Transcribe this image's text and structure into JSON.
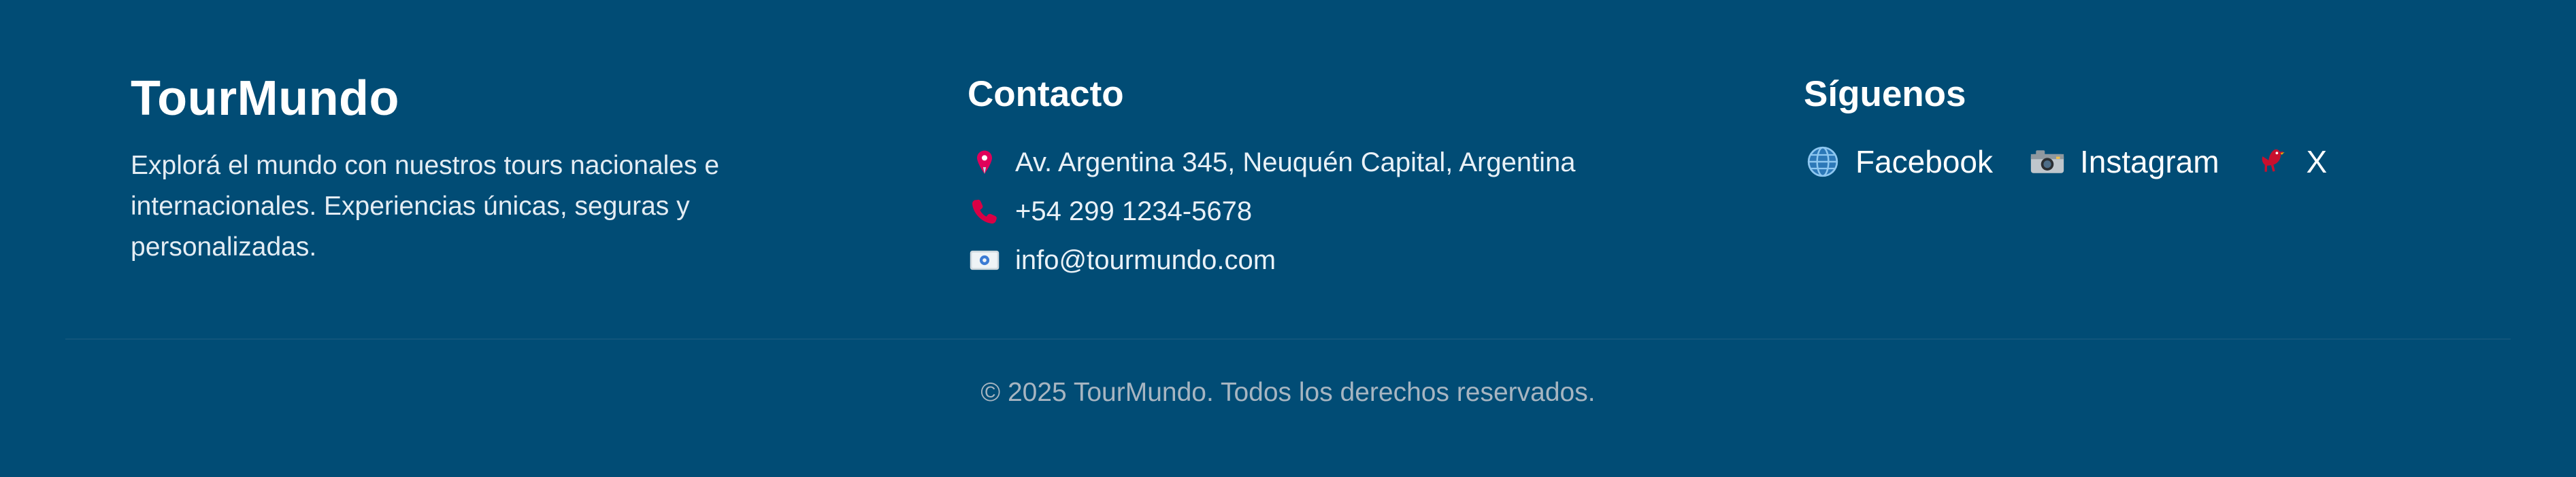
{
  "colors": {
    "background": "#014c75",
    "text_primary": "#ffffff",
    "text_secondary": "#e4edf4",
    "copyright_text": "#a7b5c1",
    "divider": "#11557b",
    "pin_icon": "#e0005a",
    "phone_icon": "#d90045",
    "globe_icon": "#4a90c2",
    "bird_icon": "#c8102e"
  },
  "brand": {
    "title": "TourMundo",
    "description": "Explorá el mundo con nuestros tours nacionales e internacionales. Experiencias únicas, seguras y personalizadas."
  },
  "contact": {
    "title": "Contacto",
    "items": [
      {
        "icon": "location-pin-icon",
        "text": "Av. Argentina 345, Neuquén Capital, Argentina"
      },
      {
        "icon": "phone-icon",
        "text": "+54 299 1234-5678"
      },
      {
        "icon": "email-icon",
        "text": "info@tourmundo.com"
      }
    ]
  },
  "social": {
    "title": "Síguenos",
    "links": [
      {
        "icon": "globe-icon",
        "label": "Facebook"
      },
      {
        "icon": "camera-icon",
        "label": "Instagram"
      },
      {
        "icon": "bird-icon",
        "label": "X"
      }
    ]
  },
  "footer": {
    "copyright": "© 2025 TourMundo. Todos los derechos reservados."
  }
}
